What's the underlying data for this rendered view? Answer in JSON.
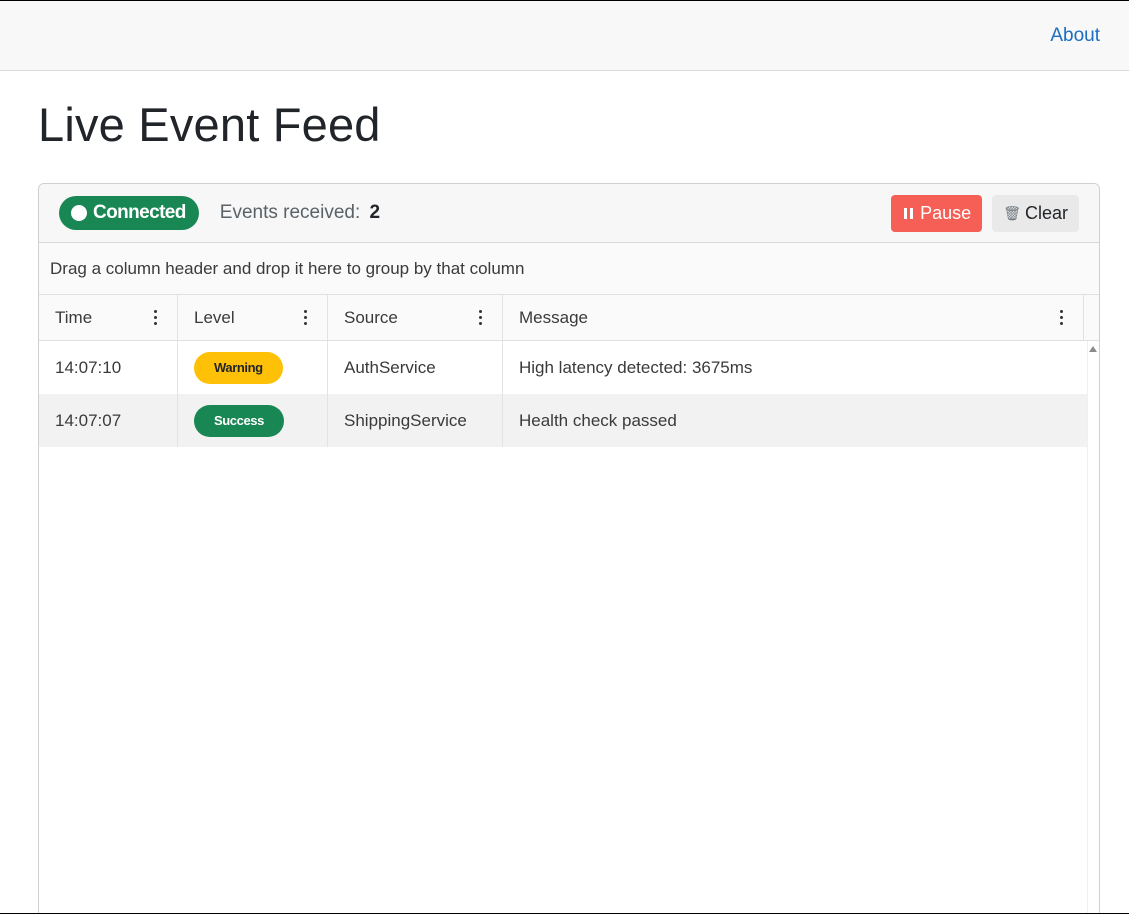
{
  "nav": {
    "about_label": "About"
  },
  "page": {
    "title": "Live Event Feed"
  },
  "feed": {
    "status_label": "Connected",
    "events_label": "Events received:",
    "events_count": "2",
    "pause_label": "Pause",
    "clear_label": "Clear",
    "status_color": "#198754",
    "pause_color": "#f55f55"
  },
  "grid": {
    "group_panel_text": "Drag a column header and drop it here to group by that column",
    "columns": [
      "Time",
      "Level",
      "Source",
      "Message"
    ],
    "rows": [
      {
        "time": "14:07:10",
        "level": "Warning",
        "source": "AuthService",
        "message": "High latency detected: 3675ms"
      },
      {
        "time": "14:07:07",
        "level": "Success",
        "source": "ShippingService",
        "message": "Health check passed"
      }
    ]
  },
  "icons": {
    "status": "circle-icon",
    "pause": "pause-icon",
    "clear": "trash-icon",
    "column_menu": "kebab-menu-icon",
    "scroll_up": "triangle-up-icon"
  }
}
